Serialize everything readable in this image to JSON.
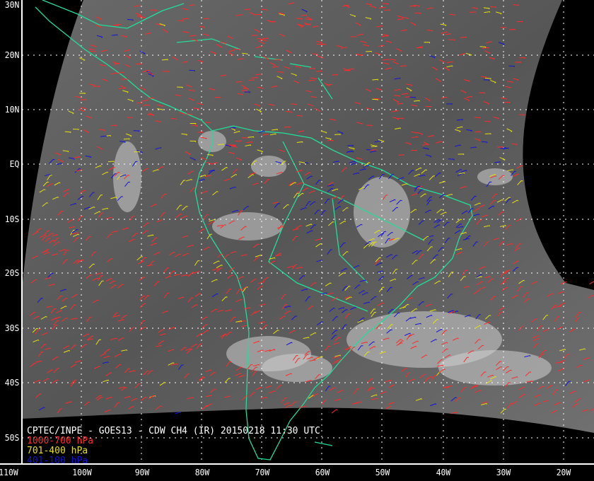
{
  "title": "CPTEC/INPE - GOES13 - CDW CH4 (IR) 20150218 11:30 UTC",
  "legend": [
    {
      "label": "1000-700 hPa",
      "color": "#ff2a2a"
    },
    {
      "label": "701-400 hPa",
      "color": "#e6e010"
    },
    {
      "label": "401-100 hPa",
      "color": "#1414d8"
    }
  ],
  "lat_labels": [
    "30N",
    "20N",
    "10N",
    "EQ",
    "10S",
    "20S",
    "30S",
    "40S",
    "50S"
  ],
  "lon_labels": [
    "110W",
    "100W",
    "90W",
    "80W",
    "70W",
    "60W",
    "50W",
    "40W",
    "30W",
    "20W"
  ],
  "colors": {
    "coast": "#22dd99",
    "grid": "#ffffff",
    "axis": "#ffffff"
  }
}
